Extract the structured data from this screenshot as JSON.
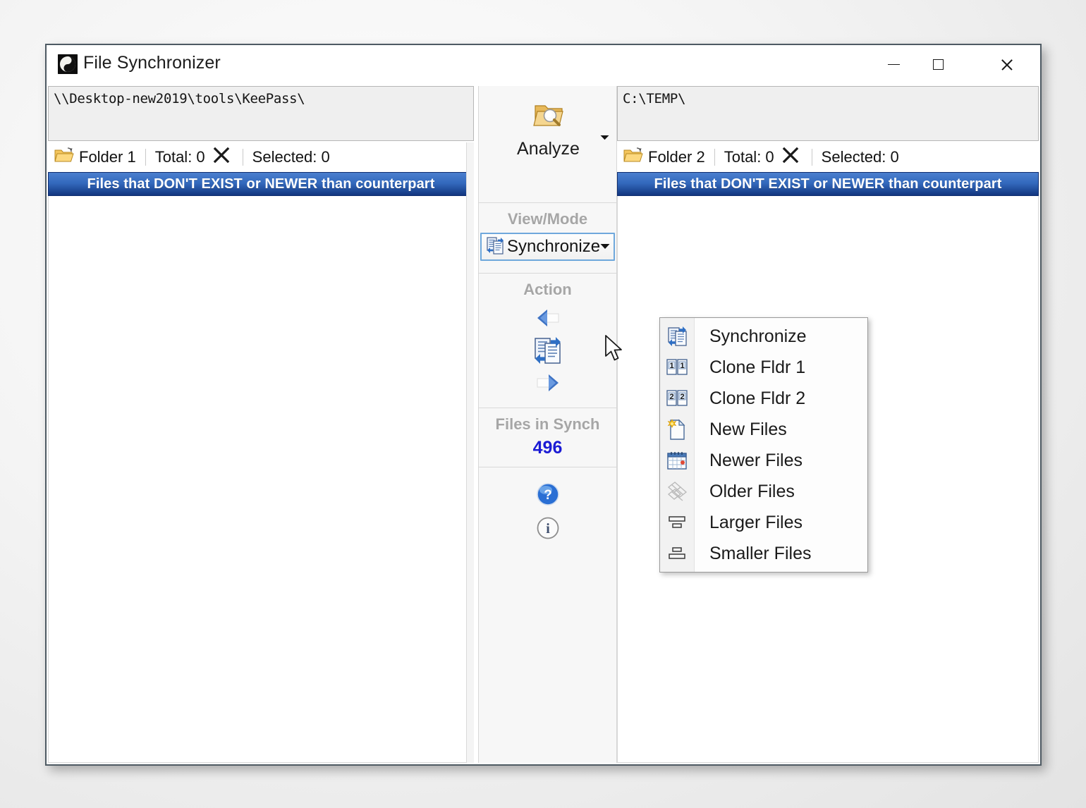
{
  "window": {
    "title": "File Synchronizer",
    "app_icon": "yinyang-icon",
    "controls": {
      "minimize": "minimize-icon",
      "maximize": "maximize-icon",
      "close": "close-icon"
    }
  },
  "folder1": {
    "path": "\\\\Desktop-new2019\\tools\\KeePass\\",
    "label": "Folder 1",
    "total_label": "Total: 0",
    "selected_label": "Selected: 0",
    "clear_icon": "x-clear-icon",
    "header_bar": "Files that DON'T EXIST or NEWER than counterpart"
  },
  "folder2": {
    "path": "C:\\TEMP\\",
    "label": "Folder 2",
    "total_label": "Total: 0",
    "selected_label": "Selected: 0",
    "clear_icon": "x-clear-icon",
    "header_bar": "Files that DON'T EXIST or NEWER than counterpart"
  },
  "center": {
    "analyze_label": "Analyze",
    "analyze_icon": "folder-search-icon",
    "analyze_dropdown_icon": "chevron-down-icon",
    "view_mode_label": "View/Mode",
    "mode_value": "Synchronize",
    "mode_icon": "synchronize-icon",
    "mode_arrow_icon": "chevron-down-icon",
    "action_label": "Action",
    "action_left_icon": "arrow-left-icon",
    "action_sync_icon": "synchronize-icon",
    "action_right_icon": "arrow-right-icon",
    "files_in_synch_label": "Files in Synch",
    "files_in_synch_count": "496",
    "help_icon": "help-icon",
    "info_icon": "info-icon"
  },
  "mode_menu": {
    "items": [
      {
        "label": "Synchronize",
        "icon": "synchronize-icon"
      },
      {
        "label": "Clone Fldr 1",
        "icon": "clone-folder-1-icon"
      },
      {
        "label": "Clone Fldr 2",
        "icon": "clone-folder-2-icon"
      },
      {
        "label": "New Files",
        "icon": "new-files-icon"
      },
      {
        "label": "Newer Files",
        "icon": "newer-files-calendar-icon"
      },
      {
        "label": "Older Files",
        "icon": "older-files-icon"
      },
      {
        "label": "Larger Files",
        "icon": "larger-files-icon"
      },
      {
        "label": "Smaller Files",
        "icon": "smaller-files-icon"
      }
    ]
  },
  "colors": {
    "accent_blue": "#3369bd",
    "count_blue": "#1b1bd4",
    "section_gray": "#a6a6a6",
    "window_border": "#4e5a63"
  }
}
